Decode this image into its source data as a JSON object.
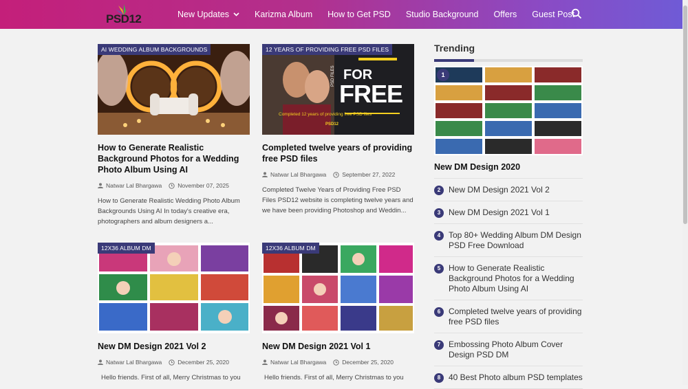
{
  "header": {
    "logo_text": "PSD12",
    "nav": [
      {
        "label": "New Updates",
        "has_dropdown": true
      },
      {
        "label": "Karizma Album"
      },
      {
        "label": "How to Get PSD"
      },
      {
        "label": "Studio Background"
      },
      {
        "label": "Offers"
      },
      {
        "label": "Guest Post"
      }
    ],
    "search_icon": "search-icon"
  },
  "posts": [
    {
      "tag": "AI WEDDING ALBUM BACKGROUNDS",
      "title": "How to Generate Realistic Background Photos for a Wedding Photo Album Using AI",
      "author": "Natwar Lal Bhargawa",
      "date": "November 07, 2025",
      "excerpt": "How to Generate Realistic Wedding Photo Album Backgrounds Using AI In today's creative era, photographers and album designers a..."
    },
    {
      "tag": "12 YEARS OF PROVIDING FREE PSD FILES",
      "title": "Completed twelve years of providing free PSD files",
      "author": "Natwar Lal Bhargawa",
      "date": "September 27, 2022",
      "excerpt": "Completed Twelve Years of Providing Free PSD Files PSD12 website is completing twelve years and we have been providing Photoshop and Weddin...",
      "image_text": {
        "for": "FOR",
        "free": "FREE",
        "psd_files": "PSD FILES",
        "caption": "Completed 12 years of providing free PSD files",
        "logo": "PSD12"
      }
    },
    {
      "tag": "12X36 ALBUM DM",
      "title": "New DM Design 2021 Vol 2",
      "author": "Natwar Lal Bhargawa",
      "date": "December 25, 2020",
      "excerpt": "Hello friends. First of all, Merry Christmas to you"
    },
    {
      "tag": "12X36 ALBUM DM",
      "title": "New DM Design 2021 Vol 1",
      "author": "Natwar Lal Bhargawa",
      "date": "December 25, 2020",
      "excerpt": "Hello friends. First of all, Merry Christmas to you"
    }
  ],
  "sidebar": {
    "title": "Trending",
    "first_badge": "1",
    "first_title": "New DM Design 2020",
    "items": [
      {
        "num": "2",
        "label": "New DM Design 2021 Vol 2"
      },
      {
        "num": "3",
        "label": "New DM Design 2021 Vol 1"
      },
      {
        "num": "4",
        "label": "Top 80+ Wedding Album DM Design PSD Free Download"
      },
      {
        "num": "5",
        "label": "How to Generate Realistic Background Photos for a Wedding Photo Album Using AI"
      },
      {
        "num": "6",
        "label": "Completed twelve years of providing free PSD files"
      },
      {
        "num": "7",
        "label": "Embossing Photo Album Cover Design PSD DM"
      },
      {
        "num": "8",
        "label": "40 Best Photo album PSD templates"
      }
    ]
  },
  "colors": {
    "accent": "#3a3a78",
    "header_start": "#c41f7a",
    "header_end": "#6f5bd6"
  }
}
